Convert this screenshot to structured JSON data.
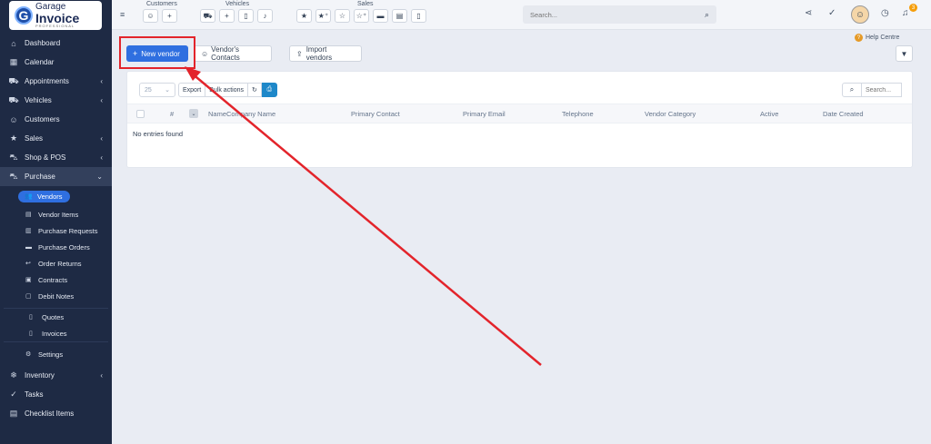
{
  "brand": {
    "logo_line1": "Garage",
    "logo_line2": "Invoice",
    "logo_line3": "PROFESSIONAL",
    "logo_mark": "G"
  },
  "sidebar": {
    "items": [
      {
        "label": "Dashboard",
        "icon": "home-icon"
      },
      {
        "label": "Calendar",
        "icon": "calendar-icon"
      },
      {
        "label": "Appointments",
        "icon": "car-icon"
      },
      {
        "label": "Vehicles",
        "icon": "car-icon"
      },
      {
        "label": "Customers",
        "icon": "user-icon"
      },
      {
        "label": "Sales",
        "icon": "star-icon"
      },
      {
        "label": "Shop & POS",
        "icon": "cart-icon"
      },
      {
        "label": "Purchase",
        "icon": "cart-icon"
      }
    ],
    "purchase_sub": [
      {
        "label": "Vendors",
        "icon": "users-icon"
      },
      {
        "label": "Vendor Items",
        "icon": "items-icon"
      },
      {
        "label": "Purchase Requests",
        "icon": "request-icon"
      },
      {
        "label": "Purchase Orders",
        "icon": "order-icon"
      },
      {
        "label": "Order Returns",
        "icon": "return-icon"
      },
      {
        "label": "Contracts",
        "icon": "contract-icon"
      },
      {
        "label": "Debit Notes",
        "icon": "note-icon"
      },
      {
        "label": "Quotes",
        "icon": "quote-icon"
      },
      {
        "label": "Invoices",
        "icon": "invoice-icon"
      },
      {
        "label": "Settings",
        "icon": "gear-icon"
      }
    ],
    "after": [
      {
        "label": "Inventory",
        "icon": "snowflake-icon"
      },
      {
        "label": "Tasks",
        "icon": "check-circle-icon"
      },
      {
        "label": "Checklist Items",
        "icon": "doc-icon"
      }
    ]
  },
  "topbar": {
    "customers_label": "Customers",
    "vehicles_label": "Vehicles",
    "sales_label": "Sales",
    "search_placeholder": "Search...",
    "notif_count": "3",
    "help_label": "Help Centre"
  },
  "actions": {
    "new_vendor": "New vendor",
    "contacts": "Vendor's Contacts",
    "import": "Import vendors"
  },
  "table": {
    "page_length": "25",
    "export_label": "Export",
    "bulk_label": "Bulk actions",
    "search_placeholder": "Search...",
    "columns": [
      "#",
      "Name",
      "Company Name",
      "Primary Contact",
      "Primary Email",
      "Telephone",
      "Vendor Category",
      "Active",
      "Date Created"
    ],
    "empty_text": "No entries found"
  },
  "colors": {
    "sidebar": "#1e2a44",
    "accent": "#2f6fe0",
    "annotation": "#e3242b"
  }
}
